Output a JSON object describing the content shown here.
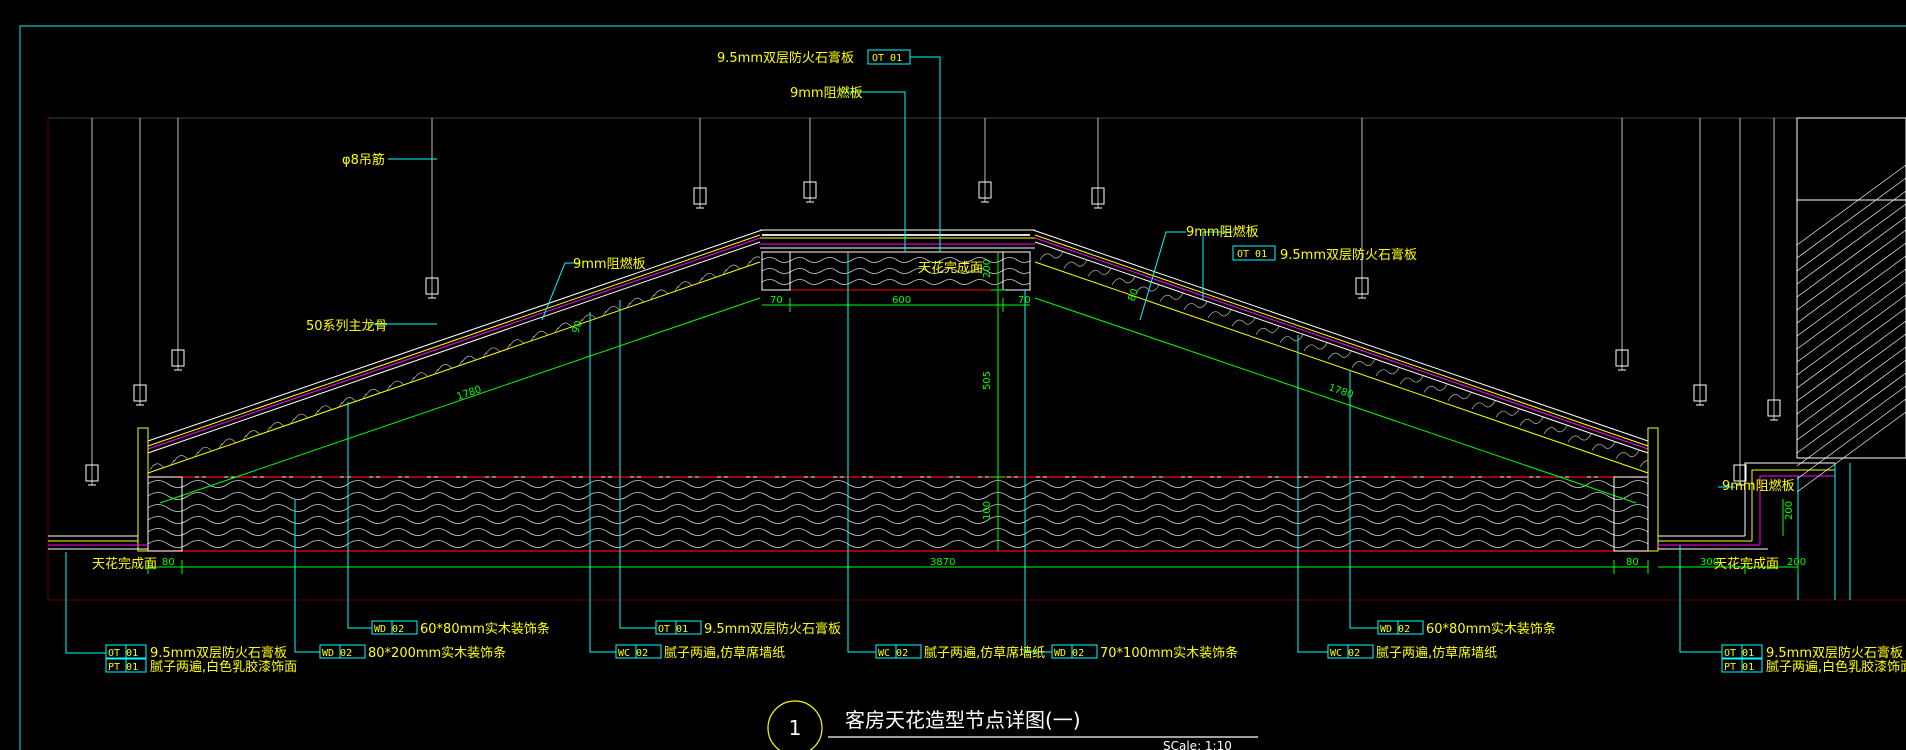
{
  "colors": {
    "background": "#000000",
    "border": "#00c8c8",
    "leader": "#00ffff",
    "text": "#ffff00",
    "dimension": "#00ff00",
    "outline": "#ffffff",
    "section_line": "#ff0000",
    "membrane": "#ff00ff"
  },
  "title": {
    "number": "1",
    "text": "客房天花造型节点详图(一)",
    "scale": "SCale: 1:10"
  },
  "labels": {
    "top_board": "9.5mm双层防火石膏板",
    "top_tag": "OT 01",
    "top_ply": "9mm阻燃板",
    "rod": "φ8吊筋",
    "main_keel": "50系列主龙骨",
    "left_ply": "9mm阻燃板",
    "right_ply": "9mm阻燃板",
    "right_board": "9.5mm双层防火石膏板",
    "right_tag": "OT 01",
    "ceiling_center": "天花完成面",
    "right_small_ply": "9mm阻燃板",
    "left_ceiling": "天花完成面",
    "right_ceiling": "天花完成面"
  },
  "bottom_callouts": [
    {
      "tag": "OT 01",
      "text": "9.5mm双层防火石膏板",
      "tag2": "PT 01",
      "text2": "腻子两遍,白色乳胶漆饰面"
    },
    {
      "tag": "WD 02",
      "text": "80*200mm实木装饰条"
    },
    {
      "tag": "WD 02",
      "text": "60*80mm实木装饰条"
    },
    {
      "tag": "WC 02",
      "text": "腻子两遍,仿草席墙纸"
    },
    {
      "tag": "OT 01",
      "text": "9.5mm双层防火石膏板"
    },
    {
      "tag": "WC 02",
      "text": "腻子两遍,仿草席墙纸"
    },
    {
      "tag": "WD 02",
      "text": "70*100mm实木装饰条"
    },
    {
      "tag": "WC 02",
      "text": "腻子两遍,仿草席墙纸"
    },
    {
      "tag": "WD 02",
      "text": "60*80mm实木装饰条"
    },
    {
      "tag": "OT 01",
      "text": "9.5mm双层防火石膏板",
      "tag2": "PT 01",
      "text2": "腻子两遍,白色乳胶漆饰面"
    }
  ],
  "dimensions": {
    "d3870": "3870",
    "d80_left": "80",
    "d80_right": "80",
    "d300": "300",
    "d200": "200",
    "d600": "600",
    "d70_left": "70",
    "d70_right": "70",
    "d505": "505",
    "d100": "100",
    "d200_v": "200",
    "d1780_left": "1780",
    "d1780_right": "1780",
    "d90_left": "90",
    "d80_right_slope": "80",
    "d200_right": "200"
  }
}
